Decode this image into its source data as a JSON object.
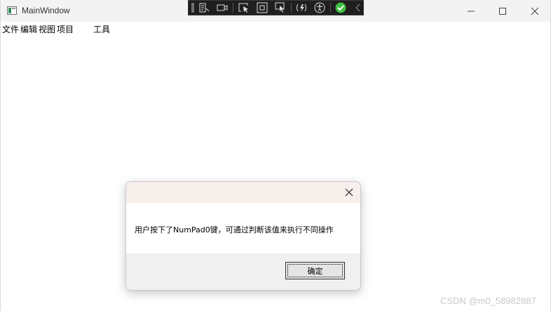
{
  "window": {
    "title": "MainWindow"
  },
  "devtoolbar": {
    "icons": [
      "live-visual-tree-icon",
      "record-icon",
      "select-element-icon",
      "display-layout-adorners-icon",
      "track-focus-icon",
      "hot-reload-icon",
      "accessibility-icon",
      "binding-check-icon",
      "collapse-chevron-icon"
    ],
    "accent_green": "#3fbf3f"
  },
  "menu": {
    "items": [
      {
        "label": "文件"
      },
      {
        "label": "编辑"
      },
      {
        "label": "视图"
      },
      {
        "label": "项目"
      },
      {
        "label": "工具"
      }
    ]
  },
  "dialog": {
    "message": "用户按下了NumPad0键，可通过判断该值来执行不同操作",
    "ok_label": "确定"
  },
  "watermark": "CSDN @m0_58982887"
}
